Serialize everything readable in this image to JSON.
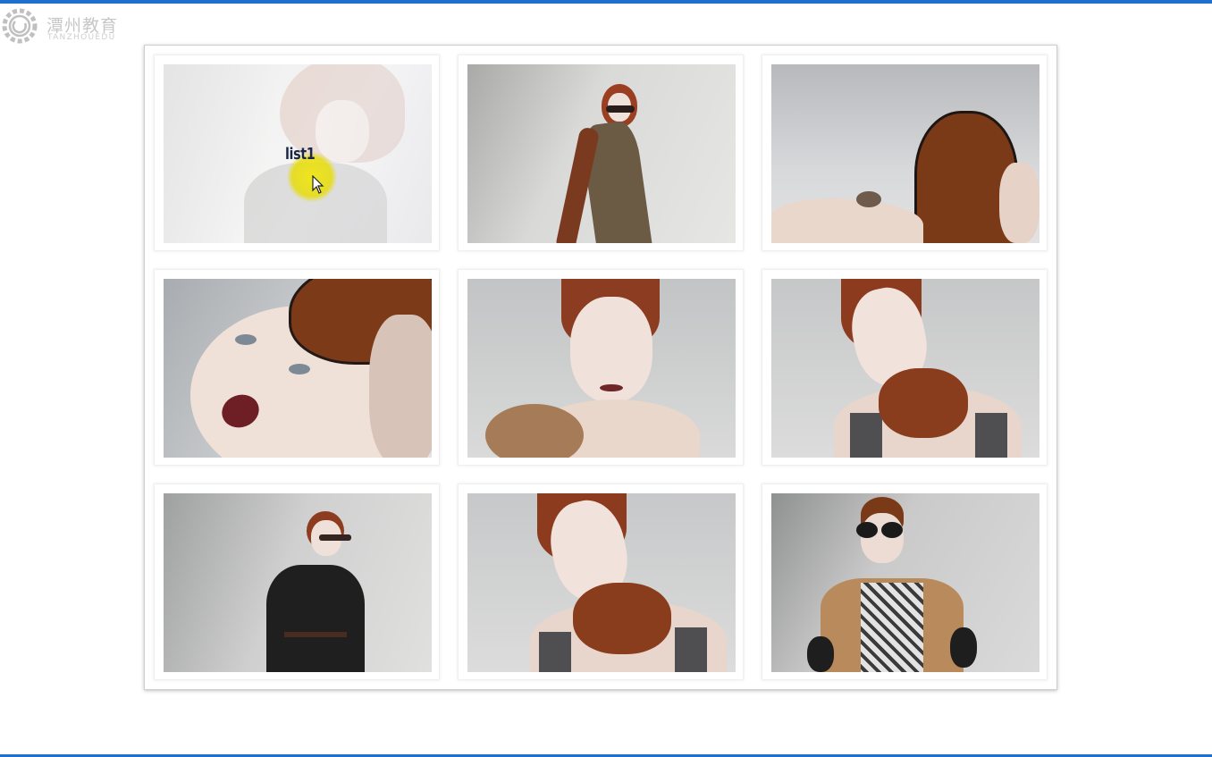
{
  "watermark": {
    "cn": "潭州教育",
    "en": "TANZHOUEDU"
  },
  "gallery": {
    "hover_label": "list1",
    "items": [
      {
        "id": "list1",
        "icon": "fashion-photo",
        "hovered": true
      },
      {
        "id": "list2",
        "icon": "fashion-photo"
      },
      {
        "id": "list3",
        "icon": "fashion-photo"
      },
      {
        "id": "list4",
        "icon": "fashion-photo"
      },
      {
        "id": "list5",
        "icon": "fashion-photo"
      },
      {
        "id": "list6",
        "icon": "fashion-photo"
      },
      {
        "id": "list7",
        "icon": "fashion-photo"
      },
      {
        "id": "list8",
        "icon": "fashion-photo"
      },
      {
        "id": "list9",
        "icon": "fashion-photo"
      }
    ]
  },
  "colors": {
    "accent_bar": "#1f6fd1",
    "cursor_highlight": "#e8dc10",
    "hair": "#8a3b1f",
    "leather": "#7a3a18"
  }
}
